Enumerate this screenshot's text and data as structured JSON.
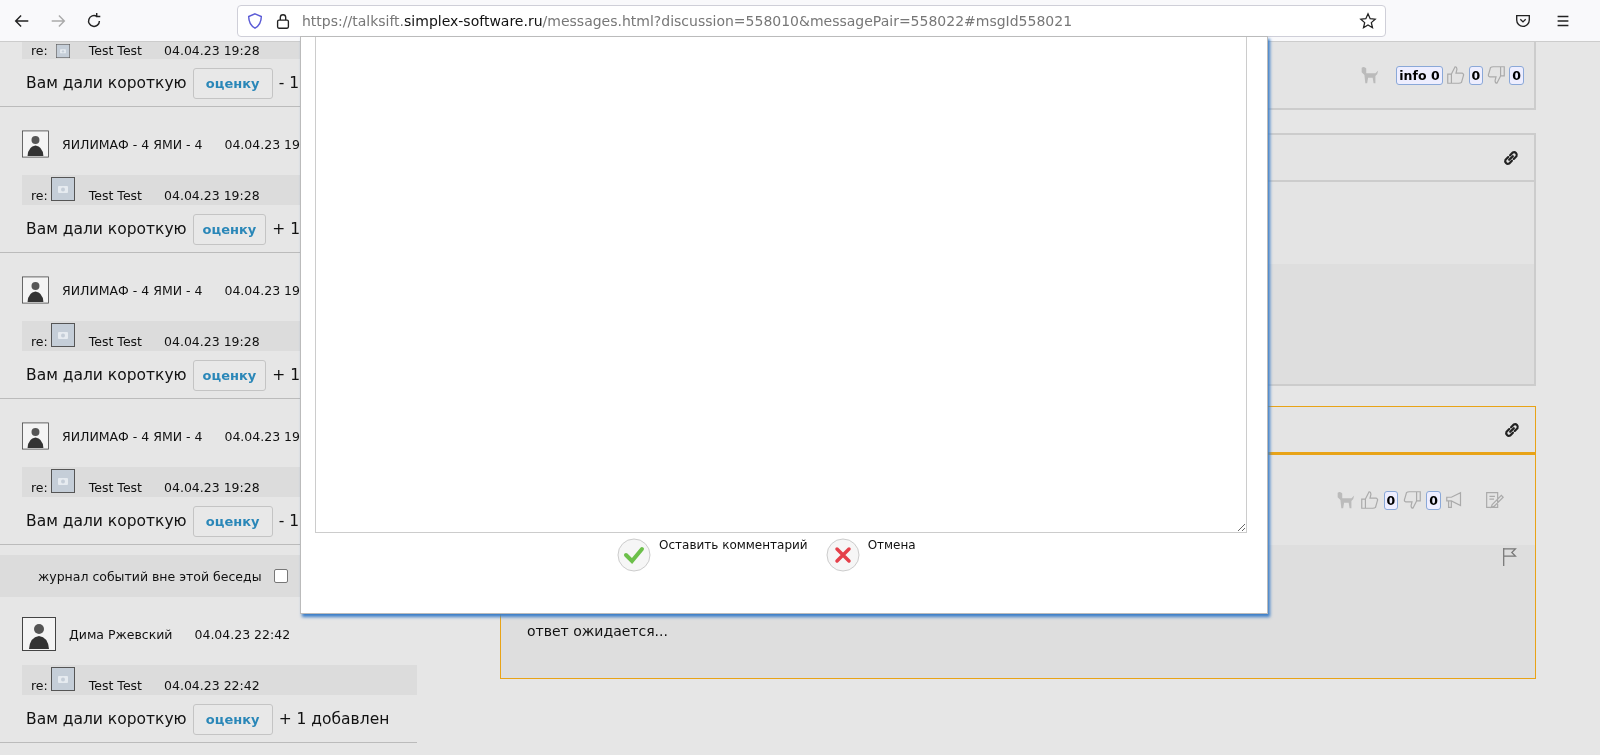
{
  "browser": {
    "url_scheme": "https://talksift.",
    "url_domain": "simplex-software.ru",
    "url_path": "/messages.html?discussion=558010&messagePair=558022#msgId558021"
  },
  "messages": [
    {
      "kind": "partial",
      "reply": {
        "prefix": "re:",
        "author": "Test Test",
        "time": "04.04.23 19:28"
      },
      "rating": {
        "text": "Вам дали короткую",
        "button": "оценку",
        "result": "- 1"
      }
    },
    {
      "kind": "full",
      "author": "ЯИЛИМАФ - 4 ЯМИ - 4",
      "time": "04.04.23 19",
      "reply": {
        "prefix": "re:",
        "author": "Test Test",
        "time": "04.04.23 19:28"
      },
      "rating": {
        "text": "Вам дали короткую",
        "button": "оценку",
        "result": "+ 1"
      }
    },
    {
      "kind": "full",
      "author": "ЯИЛИМАФ - 4 ЯМИ - 4",
      "time": "04.04.23 19",
      "reply": {
        "prefix": "re:",
        "author": "Test Test",
        "time": "04.04.23 19:28"
      },
      "rating": {
        "text": "Вам дали короткую",
        "button": "оценку",
        "result": "+ 1"
      }
    },
    {
      "kind": "full",
      "author": "ЯИЛИМАФ - 4 ЯМИ - 4",
      "time": "04.04.23 19",
      "reply": {
        "prefix": "re:",
        "author": "Test Test",
        "time": "04.04.23 19:28"
      },
      "rating": {
        "text": "Вам дали короткую",
        "button": "оценку",
        "result": "- 1"
      }
    }
  ],
  "journal": {
    "label": "журнал событий вне этой беседы",
    "checked": false
  },
  "events": [
    {
      "kind": "full",
      "author": "Дима Ржевский",
      "time": "04.04.23 22:42",
      "reply": {
        "prefix": "re:",
        "author": "Test Test",
        "time": "04.04.23 22:42"
      },
      "rating": {
        "text": "Вам дали короткую",
        "button": "оценку",
        "result": "+ 1 добавлен"
      }
    }
  ],
  "panels": [
    {
      "kind": "partial",
      "highlighted": false,
      "info_badge": "info 0",
      "likes": "0",
      "dislikes": "0"
    },
    {
      "kind": "empty",
      "highlighted": false
    },
    {
      "kind": "answer",
      "highlighted": true,
      "likes": "0",
      "dislikes": "0",
      "status": "ответ ожидается..."
    }
  ],
  "dialog": {
    "buttons": [
      {
        "kind": "confirm",
        "label": "Оставить комментарий"
      },
      {
        "kind": "cancel",
        "label": "Отмена"
      }
    ]
  }
}
